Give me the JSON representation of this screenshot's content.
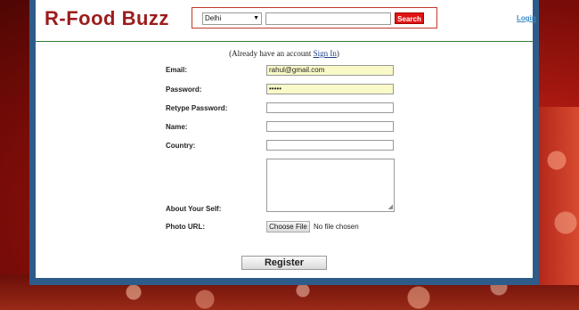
{
  "header": {
    "logo": "R-Food Buzz",
    "search": {
      "city_selected": "Delhi",
      "query": "",
      "button_label": "Search"
    },
    "login_label": "Login"
  },
  "account": {
    "prefix": "(Already have an account ",
    "signin_label": "Sign In",
    "suffix": ")"
  },
  "form": {
    "email": {
      "label": "Email:",
      "value": "rahul@gmail.com"
    },
    "password": {
      "label": "Password:",
      "value": "•••••"
    },
    "retype_password": {
      "label": "Retype Password:",
      "value": ""
    },
    "name": {
      "label": "Name:",
      "value": ""
    },
    "country": {
      "label": "Country:",
      "value": ""
    },
    "about": {
      "label": "About Your Self:",
      "value": ""
    },
    "photo": {
      "label": "Photo URL:",
      "button_label": "Choose File",
      "status": "No file chosen"
    },
    "submit_label": "Register"
  },
  "colors": {
    "logo": "#9c1c1c",
    "frame": "#2e5c8a",
    "search_button": "#e01414",
    "link": "#3a8ac8"
  }
}
